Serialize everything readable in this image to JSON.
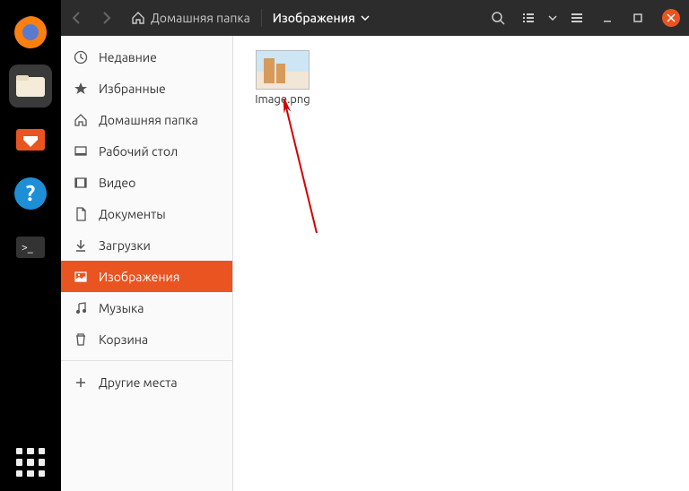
{
  "dock": {
    "items": [
      {
        "name": "firefox"
      },
      {
        "name": "files",
        "selected": true
      },
      {
        "name": "software"
      },
      {
        "name": "help"
      },
      {
        "name": "terminal"
      }
    ]
  },
  "titlebar": {
    "breadcrumb_home": "Домашняя папка",
    "breadcrumb_current": "Изображения"
  },
  "sidebar": {
    "items": [
      {
        "id": "recent",
        "label": "Недавние"
      },
      {
        "id": "starred",
        "label": "Избранные"
      },
      {
        "id": "home",
        "label": "Домашняя папка"
      },
      {
        "id": "desktop",
        "label": "Рабочий стол"
      },
      {
        "id": "videos",
        "label": "Видео"
      },
      {
        "id": "documents",
        "label": "Документы"
      },
      {
        "id": "downloads",
        "label": "Загрузки"
      },
      {
        "id": "pictures",
        "label": "Изображения",
        "active": true
      },
      {
        "id": "music",
        "label": "Музыка"
      },
      {
        "id": "trash",
        "label": "Корзина"
      }
    ],
    "other_locations": "Другие места"
  },
  "content": {
    "files": [
      {
        "name": "Image.png"
      }
    ]
  },
  "colors": {
    "accent": "#e95420"
  }
}
